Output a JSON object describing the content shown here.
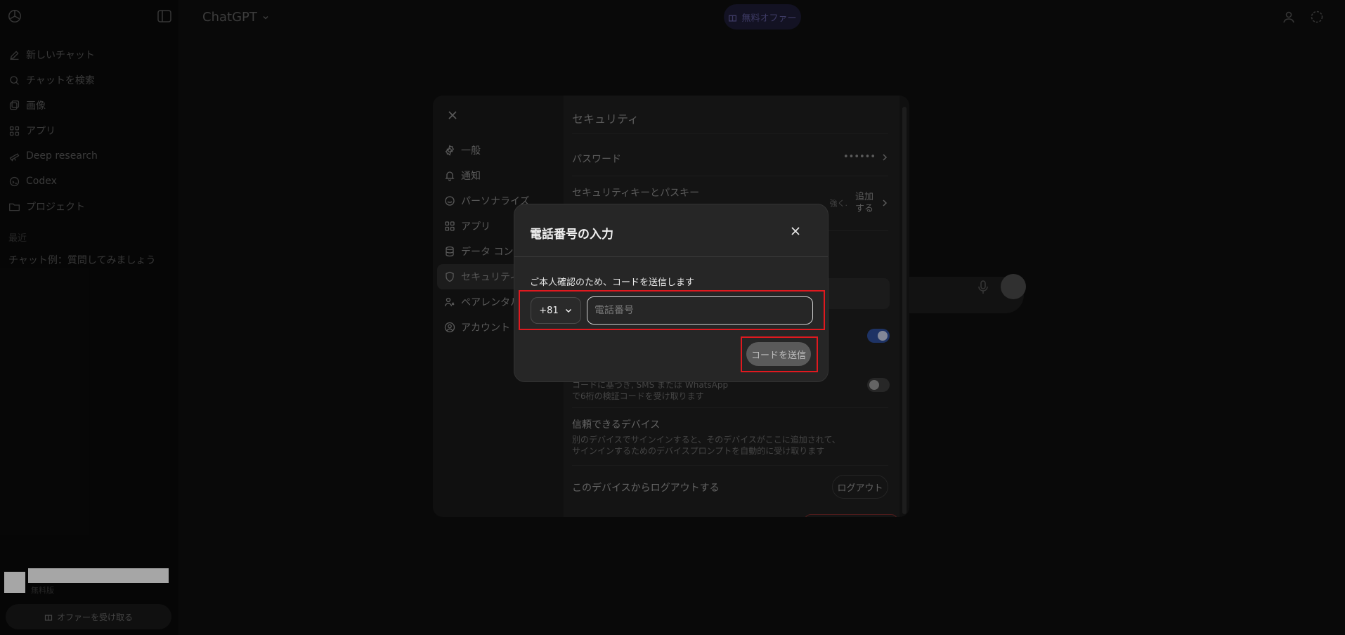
{
  "header": {
    "title": "ChatGPT",
    "offer_label": "無料オファー"
  },
  "sidebar": {
    "items": [
      {
        "label": "新しいチャット",
        "icon": "edit-icon"
      },
      {
        "label": "チャットを検索",
        "icon": "search-icon"
      },
      {
        "label": "画像",
        "icon": "image-icon"
      },
      {
        "label": "アプリ",
        "icon": "apps-icon"
      },
      {
        "label": "Deep research",
        "icon": "telescope-icon"
      },
      {
        "label": "Codex",
        "icon": "codex-icon"
      },
      {
        "label": "プロジェクト",
        "icon": "folder-icon"
      }
    ],
    "section_label": "最近",
    "chat_item": "チャット例：質問してみましょう",
    "user_plan": "無料版",
    "offer_button": "オファーを受け取る"
  },
  "settings": {
    "nav": [
      {
        "label": "一般",
        "icon": "gear-icon"
      },
      {
        "label": "通知",
        "icon": "bell-icon"
      },
      {
        "label": "パーソナライズ",
        "icon": "personalize-icon"
      },
      {
        "label": "アプリ",
        "icon": "apps-icon"
      },
      {
        "label": "データ コントロール",
        "icon": "database-icon"
      },
      {
        "label": "セキュリティ",
        "icon": "shield-icon"
      },
      {
        "label": "ペアレンタル コントロール",
        "icon": "parent-icon"
      },
      {
        "label": "アカウント",
        "icon": "account-icon"
      }
    ],
    "title": "セキュリティ",
    "password_label": "パスワード",
    "password_value": "••••••",
    "passkey_label": "セキュリティキーとパスキー",
    "passkey_sub": "強く.",
    "passkey_action": "追加する",
    "sms_sub_line1": "コードに基づき, SMS または WhatsApp",
    "sms_sub_line2": "で6桁の検証コードを受け取ります",
    "trusted_label": "信頼できるデバイス",
    "trusted_sub_line1": "別のデバイスでサインインすると、そのデバイスがここに追加されて、",
    "trusted_sub_line2": "サインインするためのデバイスプロンプトを自動的に受け取ります",
    "logout_label": "このデバイスからログアウトする",
    "logout_button": "ログアウト"
  },
  "modal": {
    "title": "電話番号の入力",
    "description": "ご本人確認のため、コードを送信します",
    "country_code": "+81",
    "phone_placeholder": "電話番号",
    "phone_value": "",
    "send_button": "コードを送信",
    "highlight_color": "#e0191f"
  }
}
